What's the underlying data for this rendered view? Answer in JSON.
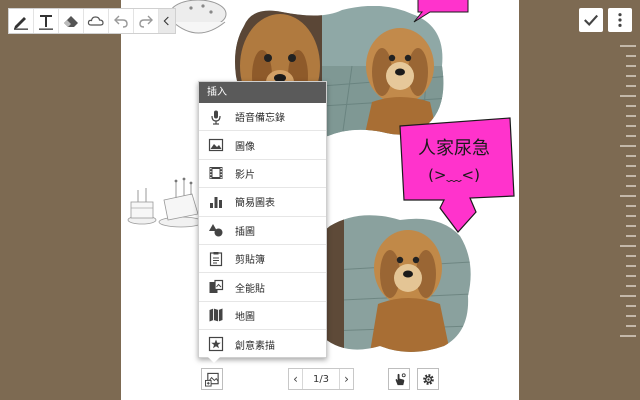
{
  "toolbar": {
    "tools": [
      "pen-icon",
      "text-icon",
      "eraser-icon",
      "cloud-icon",
      "undo-icon",
      "redo-icon",
      "collapse-icon"
    ]
  },
  "insert_menu": {
    "title": "插入",
    "items": [
      {
        "label": "語音備忘錄",
        "icon": "microphone-icon"
      },
      {
        "label": "圖像",
        "icon": "image-icon"
      },
      {
        "label": "影片",
        "icon": "film-icon"
      },
      {
        "label": "簡易圖表",
        "icon": "chart-icon"
      },
      {
        "label": "插圖",
        "icon": "shapes-icon"
      },
      {
        "label": "剪貼簿",
        "icon": "clipboard-icon"
      },
      {
        "label": "全能貼",
        "icon": "scrapbook-icon"
      },
      {
        "label": "地圖",
        "icon": "map-icon"
      },
      {
        "label": "創意素描",
        "icon": "sketch-star-icon"
      }
    ]
  },
  "sticker": {
    "line1": "人家尿急",
    "line2": "(>﹏<)"
  },
  "pager": {
    "indicator": "1/3"
  },
  "colors": {
    "background": "#7d6a52",
    "sticker": "#ff33cc",
    "menu_header": "#5a5a5a"
  }
}
